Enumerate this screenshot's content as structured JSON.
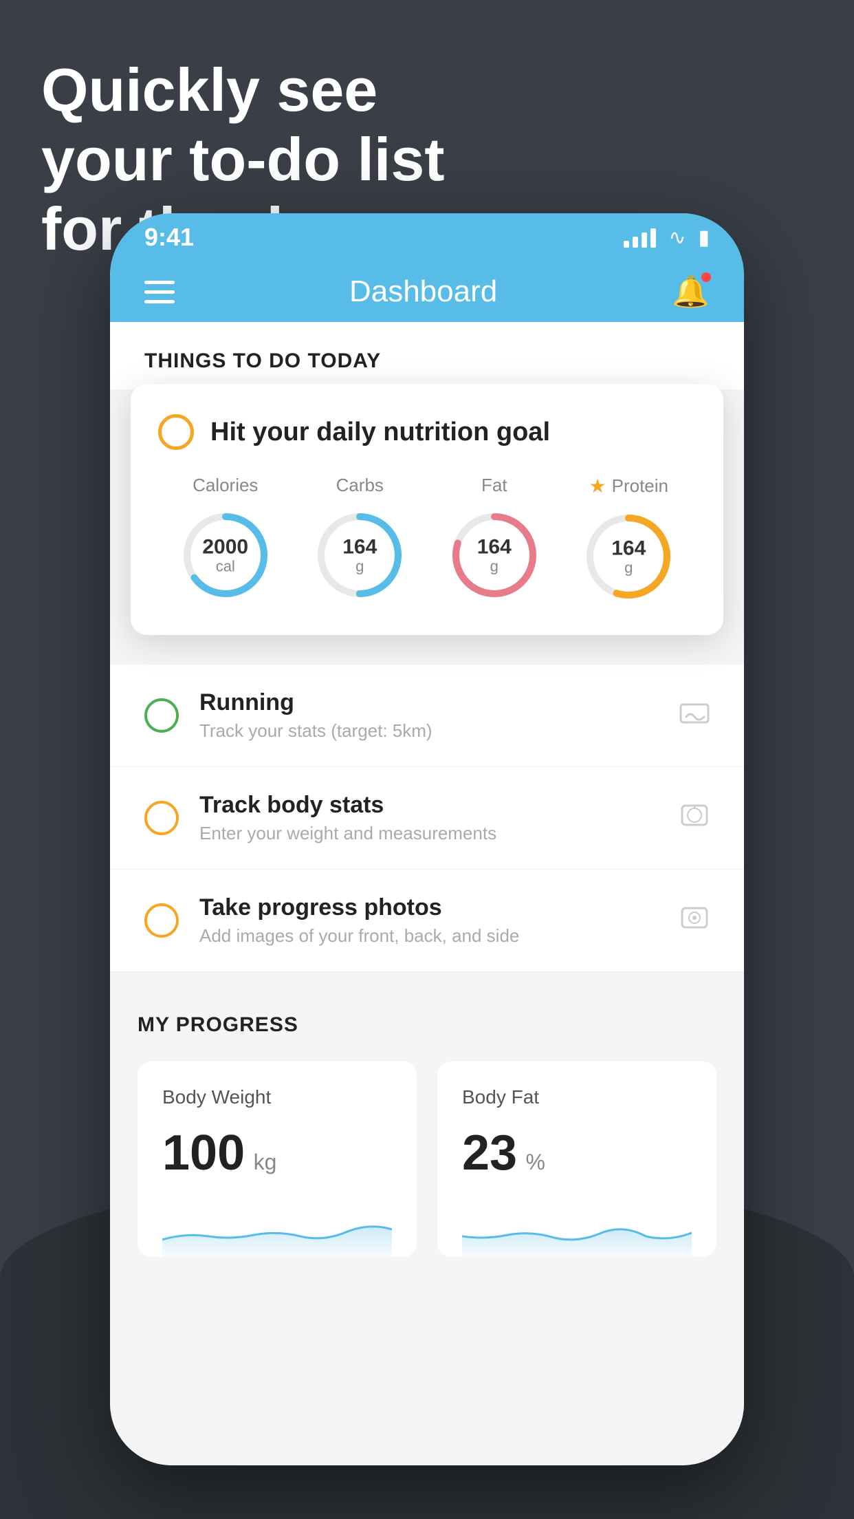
{
  "hero": {
    "line1": "Quickly see",
    "line2": "your to-do list",
    "line3": "for the day."
  },
  "statusBar": {
    "time": "9:41",
    "signalBars": [
      10,
      18,
      26,
      34
    ],
    "wifiSymbol": "📶",
    "batterySymbol": "🔋"
  },
  "navbar": {
    "title": "Dashboard"
  },
  "sectionToday": {
    "title": "THINGS TO DO TODAY"
  },
  "nutritionCard": {
    "title": "Hit your daily nutrition goal",
    "stats": [
      {
        "label": "Calories",
        "value": "2000",
        "unit": "cal",
        "color": "#57bce8",
        "pct": 65
      },
      {
        "label": "Carbs",
        "value": "164",
        "unit": "g",
        "color": "#57bce8",
        "pct": 50
      },
      {
        "label": "Fat",
        "value": "164",
        "unit": "g",
        "color": "#e87b8a",
        "pct": 80
      },
      {
        "label": "Protein",
        "value": "164",
        "unit": "g",
        "color": "#f5a623",
        "pct": 55,
        "starred": true
      }
    ]
  },
  "todoItems": [
    {
      "circleColor": "green",
      "title": "Running",
      "subtitle": "Track your stats (target: 5km)",
      "icon": "👟"
    },
    {
      "circleColor": "yellow",
      "title": "Track body stats",
      "subtitle": "Enter your weight and measurements",
      "icon": "⚖️"
    },
    {
      "circleColor": "yellow",
      "title": "Take progress photos",
      "subtitle": "Add images of your front, back, and side",
      "icon": "🖼️"
    }
  ],
  "progressSection": {
    "title": "MY PROGRESS",
    "cards": [
      {
        "title": "Body Weight",
        "value": "100",
        "unit": "kg"
      },
      {
        "title": "Body Fat",
        "value": "23",
        "unit": "%"
      }
    ]
  }
}
